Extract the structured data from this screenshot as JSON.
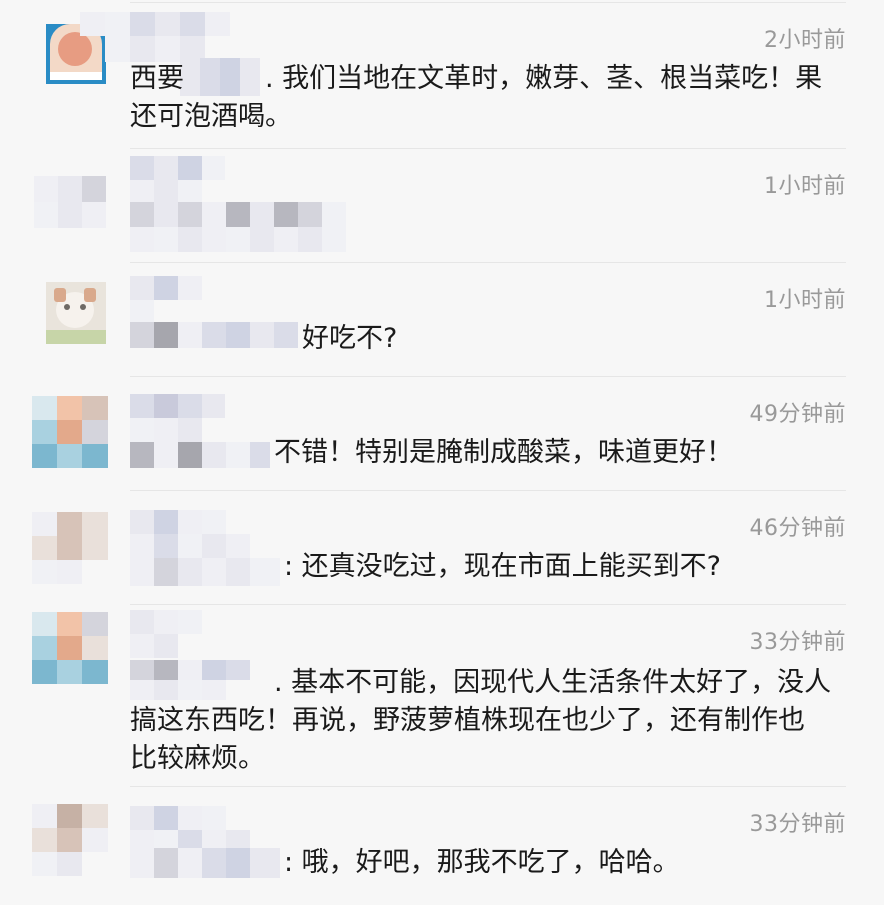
{
  "comments": [
    {
      "time": "2小时前",
      "text": "西要　　　. 我们当地在文革时，嫩芽、茎、根当菜吃！果\n还可泡酒喝。"
    },
    {
      "time": "1小时前",
      "text": ""
    },
    {
      "time": "1小时前",
      "text": "好吃不?"
    },
    {
      "time": "49分钟前",
      "text": "不错！特别是腌制成酸菜，味道更好！"
    },
    {
      "time": "46分钟前",
      "text": ": 还真没吃过，现在市面上能买到不?"
    },
    {
      "time": "33分钟前",
      "text": ". 基本不可能，因现代人生活条件太好了，没人\n搞这东西吃！再说，野菠萝植株现在也少了，还有制作也\n比较麻烦。"
    },
    {
      "time": "33分钟前",
      "text": ": 哦，好吧，那我不吃了，哈哈。"
    }
  ]
}
